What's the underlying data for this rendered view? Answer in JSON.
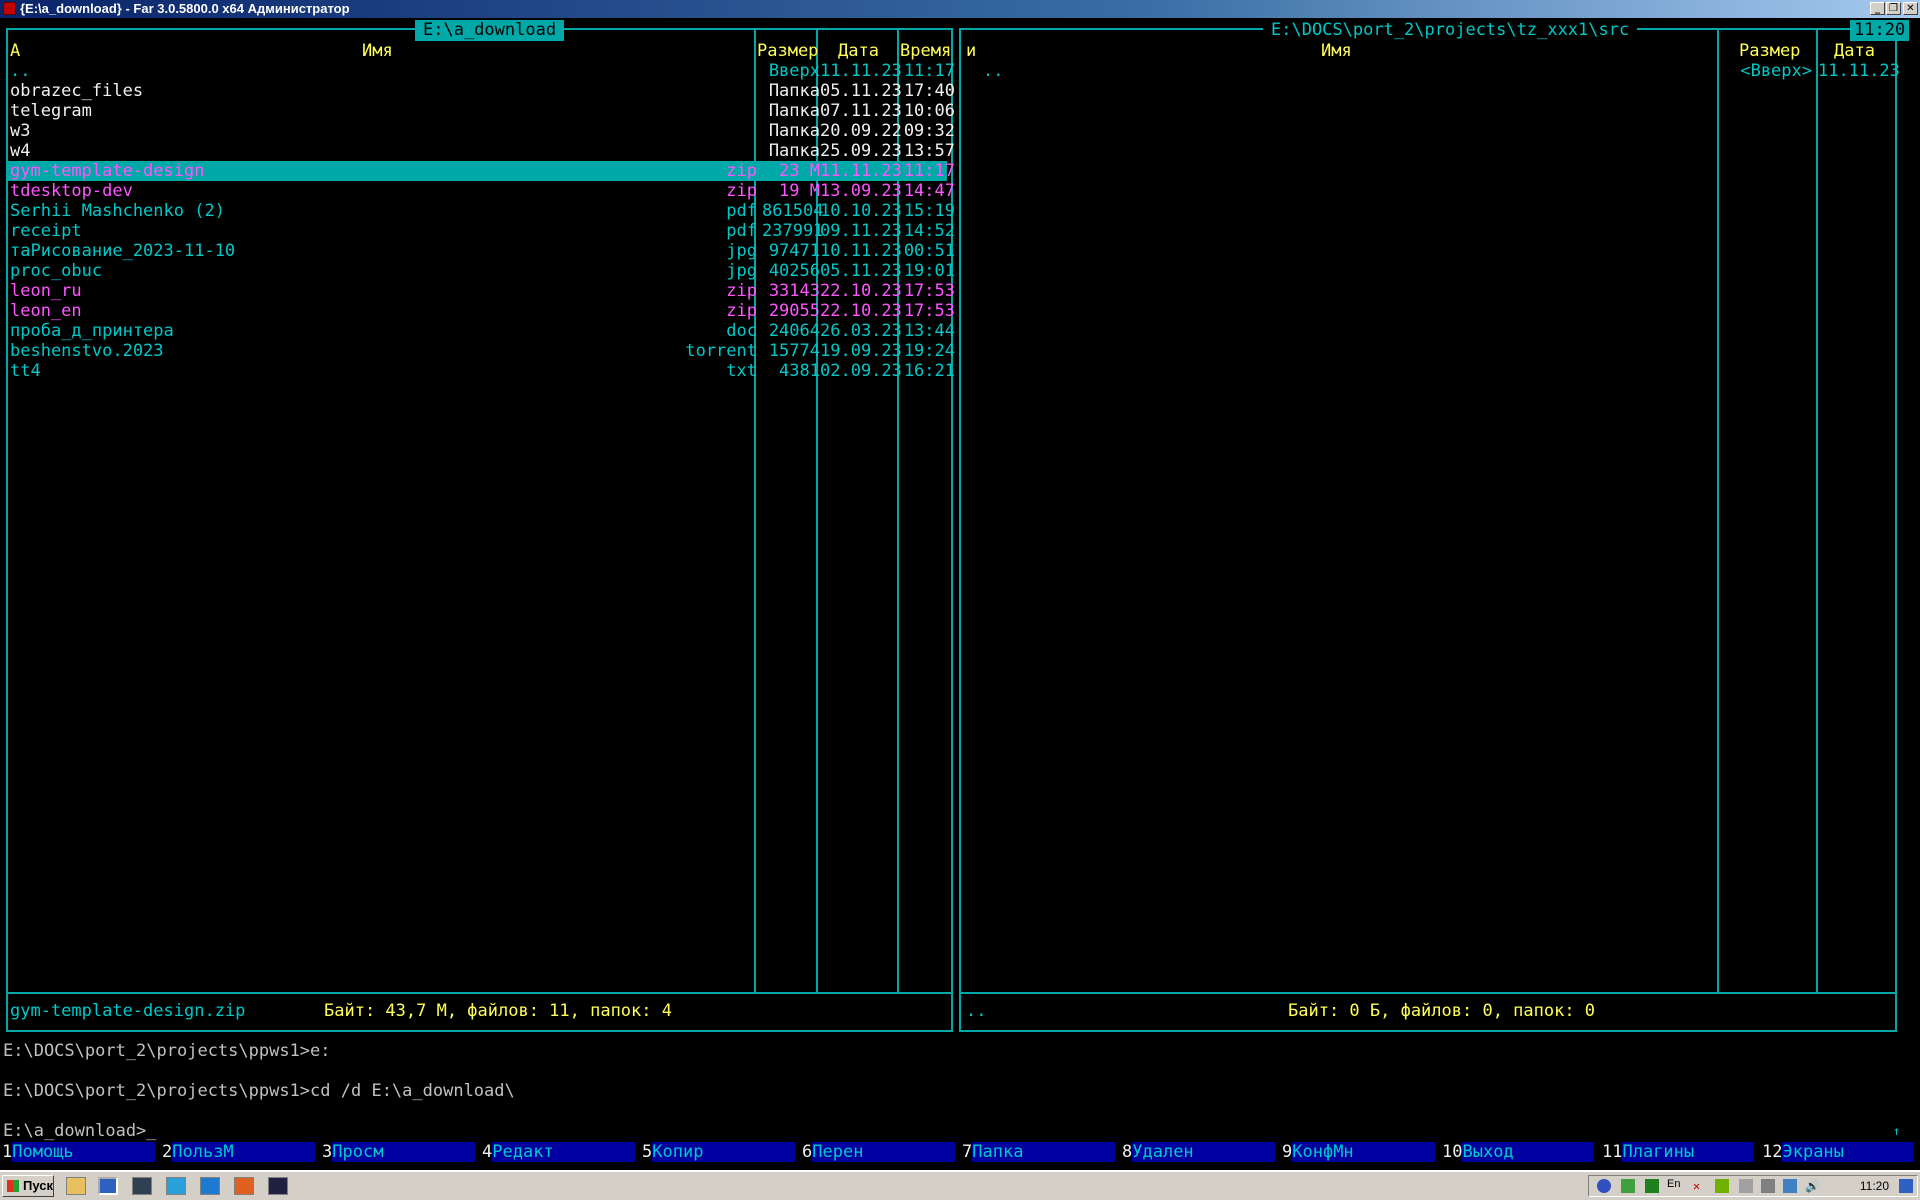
{
  "window": {
    "title": "{E:\\a_download} - Far 3.0.5800.0 x64 Администратор",
    "clock": "11:20"
  },
  "left_panel": {
    "title": "E:\\a_download",
    "headers": {
      "sort": "A",
      "name": "Имя",
      "size": "Размер",
      "date": "Дата",
      "time": "Время"
    },
    "rows": [
      {
        "name": "..",
        "ext": "",
        "size": "Вверх",
        "date": "11.11.23",
        "time": "11:17",
        "color": "cyan"
      },
      {
        "name": "obrazec_files",
        "ext": "",
        "size": "Папка",
        "date": "05.11.23",
        "time": "17:40",
        "color": "white"
      },
      {
        "name": "telegram",
        "ext": "",
        "size": "Папка",
        "date": "07.11.23",
        "time": "10:06",
        "color": "white"
      },
      {
        "name": "w3",
        "ext": "",
        "size": "Папка",
        "date": "20.09.22",
        "time": "09:32",
        "color": "white"
      },
      {
        "name": "w4",
        "ext": "",
        "size": "Папка",
        "date": "25.09.23",
        "time": "13:57",
        "color": "white"
      },
      {
        "name": "gym-template-design",
        "ext": "zip",
        "size": "23 M",
        "date": "11.11.23",
        "time": "11:17",
        "color": "magenta",
        "selected": true
      },
      {
        "name": "tdesktop-dev",
        "ext": "zip",
        "size": "19 M",
        "date": "13.09.23",
        "time": "14:47",
        "color": "magenta"
      },
      {
        "name": "Serhii Mashchenko (2)",
        "ext": "pdf",
        "size": "861504",
        "date": "10.10.23",
        "time": "15:19",
        "color": "cyan"
      },
      {
        "name": "receipt",
        "ext": "pdf",
        "size": "237991",
        "date": "09.11.23",
        "time": "14:52",
        "color": "cyan"
      },
      {
        "name": "таРисование_2023-11-10",
        "ext": "jpg",
        "size": "97471",
        "date": "10.11.23",
        "time": "00:51",
        "color": "cyan"
      },
      {
        "name": "proc_obuc",
        "ext": "jpg",
        "size": "40256",
        "date": "05.11.23",
        "time": "19:01",
        "color": "cyan"
      },
      {
        "name": "leon_ru",
        "ext": "zip",
        "size": "33143",
        "date": "22.10.23",
        "time": "17:53",
        "color": "magenta"
      },
      {
        "name": "leon_en",
        "ext": "zip",
        "size": "29055",
        "date": "22.10.23",
        "time": "17:53",
        "color": "magenta"
      },
      {
        "name": "проба_д_принтера",
        "ext": "doc",
        "size": "24064",
        "date": "26.03.23",
        "time": "13:44",
        "color": "cyan"
      },
      {
        "name": "beshenstvo.2023",
        "ext": "torrent",
        "size": "15774",
        "date": "19.09.23",
        "time": "19:24",
        "color": "cyan"
      },
      {
        "name": "tt4",
        "ext": "txt",
        "size": "4381",
        "date": "02.09.23",
        "time": "16:21",
        "color": "cyan"
      }
    ],
    "current_file": "gym-template-design.zip",
    "status": "Байт: 43,7 M, файлов: 11, папок: 4"
  },
  "right_panel": {
    "title": "E:\\DOCS\\port_2\\projects\\tz_xxx1\\src",
    "headers": {
      "sort": "и",
      "name": "Имя",
      "size": "Размер",
      "date": "Дата"
    },
    "rows": [
      {
        "name": "..",
        "size": "<Вверх>",
        "date": "11.11.23"
      }
    ],
    "current_file": "..",
    "status": "Байт: 0 Б, файлов: 0, папок: 0",
    "clock": "11:20"
  },
  "console": {
    "lines": [
      "E:\\DOCS\\port_2\\projects\\ppws1>e:",
      "",
      "E:\\DOCS\\port_2\\projects\\ppws1>cd /d E:\\a_download\\",
      "",
      "E:\\a_download>_"
    ]
  },
  "keybar": [
    {
      "num": "1",
      "label": "Помощь"
    },
    {
      "num": "2",
      "label": "ПользМ"
    },
    {
      "num": "3",
      "label": "Просм"
    },
    {
      "num": "4",
      "label": "Редакт"
    },
    {
      "num": "5",
      "label": "Копир"
    },
    {
      "num": "6",
      "label": "Перен"
    },
    {
      "num": "7",
      "label": "Папка"
    },
    {
      "num": "8",
      "label": "Удален"
    },
    {
      "num": "9",
      "label": "КонфМн"
    },
    {
      "num": "10",
      "label": "Выход"
    },
    {
      "num": "11",
      "label": "Плагины"
    },
    {
      "num": "12",
      "label": "Экраны"
    }
  ],
  "taskbar": {
    "start_label": "Пуск",
    "lang": "En",
    "clock": "11:20"
  },
  "colors": {
    "panel_border": "#00a8a8",
    "text_cyan": "#00c8c8",
    "text_yellow": "#ffff55",
    "text_magenta": "#ff55ff",
    "keybar_bg": "#0000a0"
  }
}
